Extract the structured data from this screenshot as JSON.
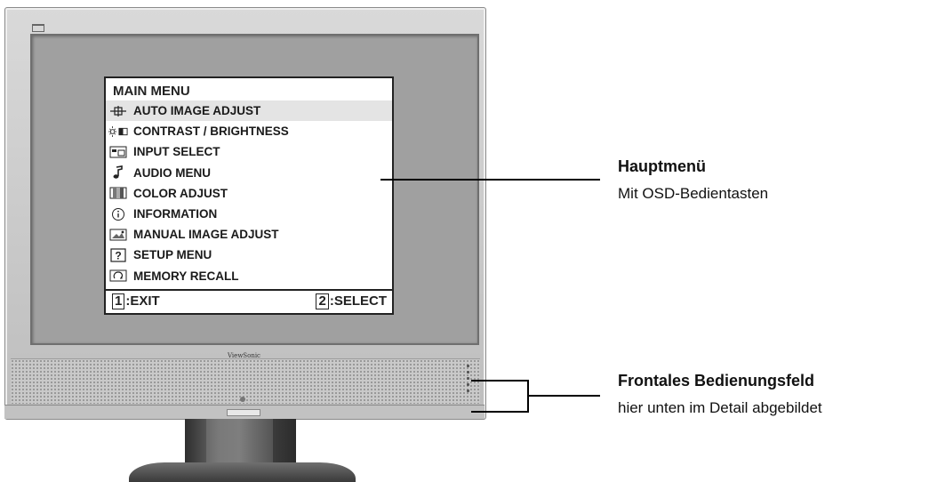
{
  "monitor": {
    "brand": "ViewSonic"
  },
  "osd": {
    "title": "MAIN MENU",
    "items": [
      {
        "label": "AUTO IMAGE ADJUST",
        "icon": "auto-adjust-icon",
        "selected": true
      },
      {
        "label": "CONTRAST / BRIGHTNESS",
        "icon": "contrast-brightness-icon",
        "selected": false
      },
      {
        "label": "INPUT SELECT",
        "icon": "input-select-icon",
        "selected": false
      },
      {
        "label": "AUDIO MENU",
        "icon": "audio-icon",
        "selected": false
      },
      {
        "label": "COLOR ADJUST",
        "icon": "color-adjust-icon",
        "selected": false
      },
      {
        "label": "INFORMATION",
        "icon": "information-icon",
        "selected": false
      },
      {
        "label": "MANUAL IMAGE ADJUST",
        "icon": "manual-adjust-icon",
        "selected": false
      },
      {
        "label": "SETUP MENU",
        "icon": "setup-icon",
        "selected": false
      },
      {
        "label": "MEMORY RECALL",
        "icon": "memory-recall-icon",
        "selected": false
      }
    ],
    "footer": {
      "exit_key": "1",
      "exit_label": ":EXIT",
      "select_key": "2",
      "select_label": ":SELECT"
    }
  },
  "callouts": {
    "main_menu": {
      "title": "Hauptmenü",
      "subtitle": "Mit OSD-Bedientasten"
    },
    "front_panel": {
      "title": "Frontales Bedienungsfeld",
      "subtitle": "hier unten im Detail abgebildet"
    }
  },
  "colors": {
    "bezel": "#c8c8c8",
    "screen": "#a0a0a0",
    "osd_background": "#ffffff",
    "osd_selected": "#e4e4e4",
    "stand": "#3a3a3a",
    "line": "#000000"
  }
}
